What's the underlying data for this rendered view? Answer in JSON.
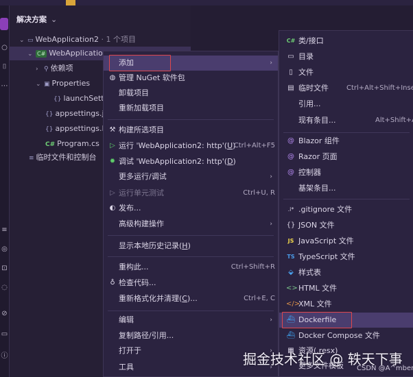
{
  "explorer": {
    "title": "解决方案",
    "tree": [
      {
        "label": "WebApplication2",
        "suffix": " · 1 个项目"
      },
      {
        "label": "WebApplication",
        "badge": "C#"
      },
      {
        "label": "依赖项"
      },
      {
        "label": "Properties"
      },
      {
        "label": "launchSett"
      },
      {
        "label": "appsettings.js"
      },
      {
        "label": "appsettings.D"
      },
      {
        "label": "Program.cs",
        "badge": "C#"
      },
      {
        "label": "临时文件和控制台"
      }
    ]
  },
  "context_menu": {
    "items": [
      {
        "label": "添加"
      },
      {
        "label": "管理 NuGet 软件包"
      },
      {
        "label": "卸载项目"
      },
      {
        "label": "重新加载项目"
      },
      {
        "label": "构建所选项目"
      },
      {
        "label": "运行 'WebApplication2: http'(",
        "underline": "U",
        "tail": ")",
        "shortcut": "Ctrl+Alt+F5"
      },
      {
        "label": "调试 'WebApplication2: http'(",
        "underline": "D",
        "tail": ")"
      },
      {
        "label": "更多运行/调试"
      },
      {
        "label": "运行单元测试",
        "shortcut": "Ctrl+U, R"
      },
      {
        "label": "发布..."
      },
      {
        "label": "高级构建操作"
      },
      {
        "label": "显示本地历史记录(",
        "underline": "H",
        "tail": ")"
      },
      {
        "label": "重构此...",
        "shortcut": "Ctrl+Shift+R"
      },
      {
        "label": "检查代码..."
      },
      {
        "label": "重新格式化并清理(",
        "underline": "C",
        "tail": ")...",
        "shortcut": "Ctrl+E, C"
      },
      {
        "label": "编辑"
      },
      {
        "label": "复制路径/引用..."
      },
      {
        "label": "打开于"
      },
      {
        "label": "工具"
      }
    ]
  },
  "submenu": {
    "items": [
      {
        "label": "类/接口",
        "icon": "C#"
      },
      {
        "label": "目录"
      },
      {
        "label": "文件"
      },
      {
        "label": "临时文件",
        "shortcut": "Ctrl+Alt+Shift+Insert"
      },
      {
        "label": "引用..."
      },
      {
        "label": "现有条目...",
        "shortcut": "Alt+Shift+A"
      },
      {
        "label": "Blazor 组件"
      },
      {
        "label": "Razor 页面"
      },
      {
        "label": "控制器"
      },
      {
        "label": "基架条目..."
      },
      {
        "label": ".gitignore 文件",
        "icon": ".i*"
      },
      {
        "label": "JSON 文件",
        "icon": "{}"
      },
      {
        "label": "JavaScript 文件",
        "icon": "JS"
      },
      {
        "label": "TypeScript 文件",
        "icon": "TS"
      },
      {
        "label": "样式表"
      },
      {
        "label": "HTML 文件"
      },
      {
        "label": "XML 文件"
      },
      {
        "label": "Dockerfile"
      },
      {
        "label": "Docker Compose 文件"
      },
      {
        "label": "资源(.resx)"
      },
      {
        "label": "更多文件模板"
      }
    ]
  },
  "watermark": {
    "text": "掘金技术社区 @ 轶天下事",
    "credit": "CSDN @A^mber"
  },
  "colors": {
    "background": "#241d33",
    "menu_bg": "#2b2340",
    "highlight_row": "#4a3d6e",
    "red_box": "#e0474c",
    "accent_purple": "#8b3fb8"
  }
}
